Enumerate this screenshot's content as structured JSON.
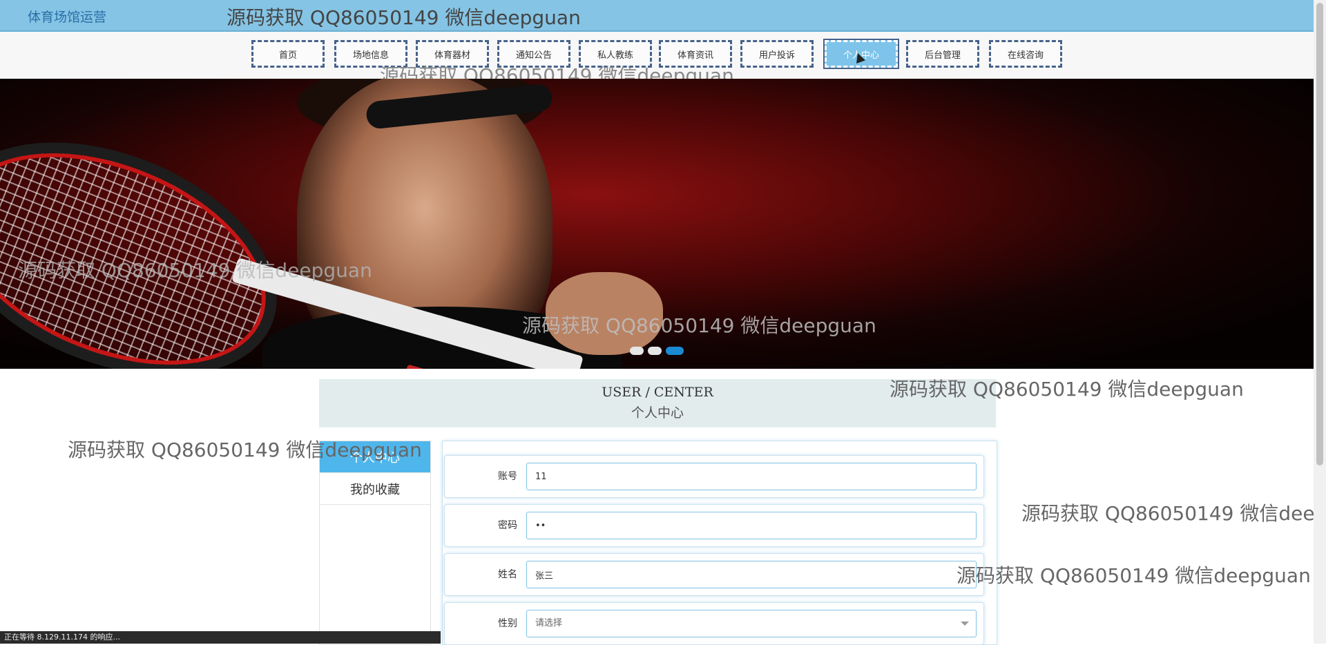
{
  "header": {
    "site_title": "体育场馆运营",
    "watermark": "源码获取 QQ86050149 微信deepguan"
  },
  "nav": {
    "items": [
      {
        "label": "首页",
        "name": "nav-home"
      },
      {
        "label": "场地信息",
        "name": "nav-venue"
      },
      {
        "label": "体育器材",
        "name": "nav-equipment"
      },
      {
        "label": "通知公告",
        "name": "nav-notice"
      },
      {
        "label": "私人教练",
        "name": "nav-coach"
      },
      {
        "label": "体育资讯",
        "name": "nav-news"
      },
      {
        "label": "用户投诉",
        "name": "nav-complaint"
      },
      {
        "label": "个人中心",
        "name": "nav-profile"
      },
      {
        "label": "后台管理",
        "name": "nav-admin"
      },
      {
        "label": "在线咨询",
        "name": "nav-consult"
      }
    ],
    "active_index": 7
  },
  "banner": {
    "slides": 3,
    "active_slide": 3
  },
  "center": {
    "title_en": "USER / CENTER",
    "title_cn": "个人中心"
  },
  "side_menu": {
    "items": [
      {
        "label": "个人中心",
        "active": true
      },
      {
        "label": "我的收藏",
        "active": false
      }
    ]
  },
  "form": {
    "account": {
      "label": "账号",
      "value": "11"
    },
    "password": {
      "label": "密码",
      "value": "••"
    },
    "name": {
      "label": "姓名",
      "value": "张三"
    },
    "gender": {
      "label": "性别",
      "placeholder": "请选择"
    }
  },
  "status_bar": "正在等待 8.129.11.174 的响应...",
  "colors": {
    "topbar": "#85c4e4",
    "active_nav": "#7ec4ea",
    "active_side": "#4fb6ec",
    "slider_dot_active": "#1a8bd2"
  }
}
